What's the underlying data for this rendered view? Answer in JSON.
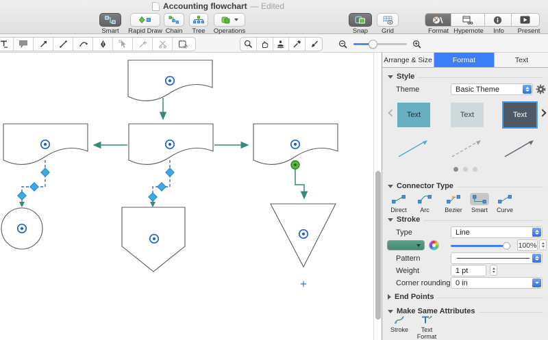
{
  "window": {
    "doc_title": "Accounting flowchart",
    "edited": "— Edited"
  },
  "toolbar": {
    "left": [
      {
        "name": "smart",
        "label": "Smart",
        "selected": true
      },
      {
        "name": "rapid-draw",
        "label": "Rapid Draw",
        "selected": false
      },
      {
        "name": "chain",
        "label": "Chain",
        "selected": false
      },
      {
        "name": "tree",
        "label": "Tree",
        "selected": false
      },
      {
        "name": "operations",
        "label": "Operations",
        "selected": false
      }
    ],
    "right": [
      {
        "name": "snap",
        "label": "Snap",
        "selected": true
      },
      {
        "name": "grid",
        "label": "Grid",
        "selected": false
      }
    ],
    "segments": [
      {
        "name": "format",
        "label": "Format",
        "selected": true
      },
      {
        "name": "hypernote",
        "label": "Hypernote",
        "selected": false
      },
      {
        "name": "info",
        "label": "Info",
        "selected": false
      },
      {
        "name": "present",
        "label": "Present",
        "selected": false
      }
    ],
    "tools": [
      "text",
      "comment",
      "draw-arrow",
      "draw-line",
      "draw-curve",
      "pen",
      "edit-node",
      "add-anchor",
      "split",
      "shape-data",
      "zoom",
      "pan-hand",
      "stamp",
      "eyedropper",
      "style-brush"
    ]
  },
  "panel": {
    "tabs": [
      {
        "label": "Arrange & Size",
        "selected": false
      },
      {
        "label": "Format",
        "selected": true
      },
      {
        "label": "Text",
        "selected": false
      }
    ],
    "style": {
      "header": "Style",
      "theme_label": "Theme",
      "theme_value": "Basic Theme",
      "swatch_label": "Text",
      "swatches": [
        {
          "bg": "#69afc2",
          "fg": "#20323a",
          "selected": false
        },
        {
          "bg": "#ced9db",
          "fg": "#39464e",
          "selected": false
        },
        {
          "bg": "#4d5965",
          "fg": "#ffffff",
          "selected": true
        }
      ],
      "pager_dots": 3,
      "active_dot": 1
    },
    "connector": {
      "header": "Connector Type",
      "options": [
        "Direct",
        "Arc",
        "Bezier",
        "Smart",
        "Curve"
      ],
      "selected": "Smart"
    },
    "stroke": {
      "header": "Stroke",
      "type_label": "Type",
      "type_value": "Line",
      "color": "#4f937f",
      "opacity": "100%",
      "pattern_label": "Pattern",
      "weight_label": "Weight",
      "weight_value": "1 pt",
      "corner_label": "Corner rounding",
      "corner_value": "0 in"
    },
    "end_points": {
      "header": "End Points"
    },
    "make_same": {
      "header": "Make Same Attributes",
      "stroke_label": "Stroke",
      "text_format_label": "Text Format"
    }
  },
  "canvas": {
    "colors": {
      "connector_teal": "#37897b",
      "selected_connector_blue": "#3a67cc",
      "center_marker_blue": "#1d62d1",
      "handle_diamond_blue": "#3fa9e8",
      "endpoint_green": "#5cb83e",
      "shape_stroke": "#5b5b5b"
    }
  }
}
